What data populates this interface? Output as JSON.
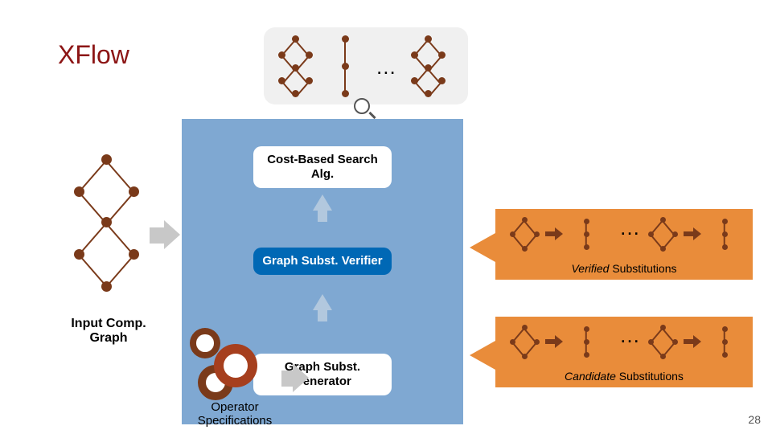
{
  "title": "XFlow",
  "slide_number": "28",
  "boxes": {
    "cost": "Cost-Based Search Alg.",
    "verifier": "Graph Subst. Verifier",
    "generator": "Graph Subst. Generator"
  },
  "labels": {
    "input_graph": "Input Comp. Graph",
    "operator_spec": "Operator Specifications",
    "verified_em": "Verified",
    "verified_rest": " Substitutions",
    "candidate_em": "Candidate",
    "candidate_rest": " Substitutions"
  },
  "ellipsis": "…"
}
